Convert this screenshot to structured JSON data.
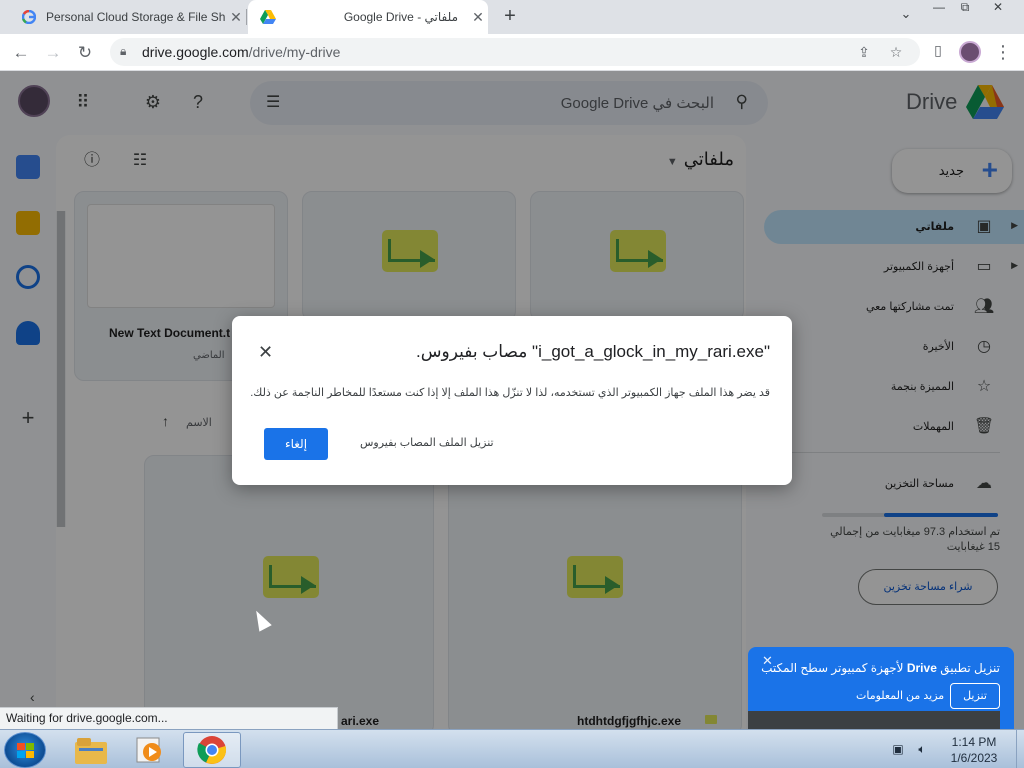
{
  "browser": {
    "tabs": [
      {
        "title": "Personal Cloud Storage & File Sh",
        "icon": "google-g-icon",
        "close": "✕"
      },
      {
        "title": "Google Drive - ملفاتي",
        "icon": "drive-logo-icon",
        "close": "✕"
      }
    ],
    "new_tab": "+",
    "window_controls": {
      "minimize": "—",
      "maximize": "⧉",
      "close": "✕"
    },
    "url_host": "drive.google.com",
    "url_path": "/drive/my-drive"
  },
  "drive": {
    "brand": "Drive",
    "search_placeholder": "البحث في Google Drive",
    "breadcrumb": "ملفاتي",
    "new_button": "جديد",
    "sidebar": [
      {
        "label": "ملفاتي",
        "icon": "my-drive-icon",
        "active": true,
        "expandable": true
      },
      {
        "label": "أجهزة الكمبيوتر",
        "icon": "computers-icon",
        "active": false,
        "expandable": true
      },
      {
        "label": "تمت مشاركتها معي",
        "icon": "shared-icon",
        "active": false,
        "expandable": false
      },
      {
        "label": "الأخيرة",
        "icon": "clock-icon",
        "active": false,
        "expandable": false
      },
      {
        "label": "المميزة بنجمة",
        "icon": "star-icon",
        "active": false,
        "expandable": false
      },
      {
        "label": "المهملات",
        "icon": "trash-icon",
        "active": false,
        "expandable": false
      },
      {
        "label": "مساحة التخزين",
        "icon": "cloud-icon",
        "active": false,
        "expandable": false
      }
    ],
    "storage_used_fraction": 0.65,
    "storage_text": "تم استخدام 97.3 ميغابايت من إجمالي 15 غيغابايت",
    "buy_storage": "شراء مساحة تخزين",
    "files": {
      "card1_name": "New Text Document.t",
      "card1_sub": "الماضي",
      "sort_label": "الاسم",
      "bottom1_name": "ari.exe",
      "bottom2_name": "htdhtdgfjgfhjc.exe"
    },
    "banner": {
      "close": "✕",
      "message_prefix": "تنزيل تطبيق",
      "message_bold": "Drive",
      "message_suffix": "لأجهزة كمبيوتر سطح المكتب",
      "more_info": "مزيد من المعلومات",
      "download": "تنزيل"
    }
  },
  "dialog": {
    "title": "\"i_got_a_glock_in_my_rari.exe\" مصاب بفيروس.",
    "body": "قد يضر هذا الملف جهاز الكمبيوتر الذي تستخدمه، لذا لا تنزّل هذا الملف إلا إذا كنت مستعدًا للمخاطر الناجمة عن ذلك.",
    "cancel_button": "إلغاء",
    "download_anyway": "تنزيل الملف المصاب بفيروس",
    "close": "✕"
  },
  "status_bar": "Waiting for drive.google.com...",
  "taskbar": {
    "apps": [
      {
        "name": "file-explorer",
        "icon": "folder-icon"
      },
      {
        "name": "media-player",
        "icon": "media-player-icon"
      },
      {
        "name": "chrome",
        "icon": "chrome-icon",
        "active": true
      }
    ],
    "time": "1:14 PM",
    "date": "1/6/2023"
  },
  "colors": {
    "accent": "#1a73e8",
    "active_nav": "#c2e7ff",
    "overlay": "rgba(0,0,0,0.42)"
  }
}
